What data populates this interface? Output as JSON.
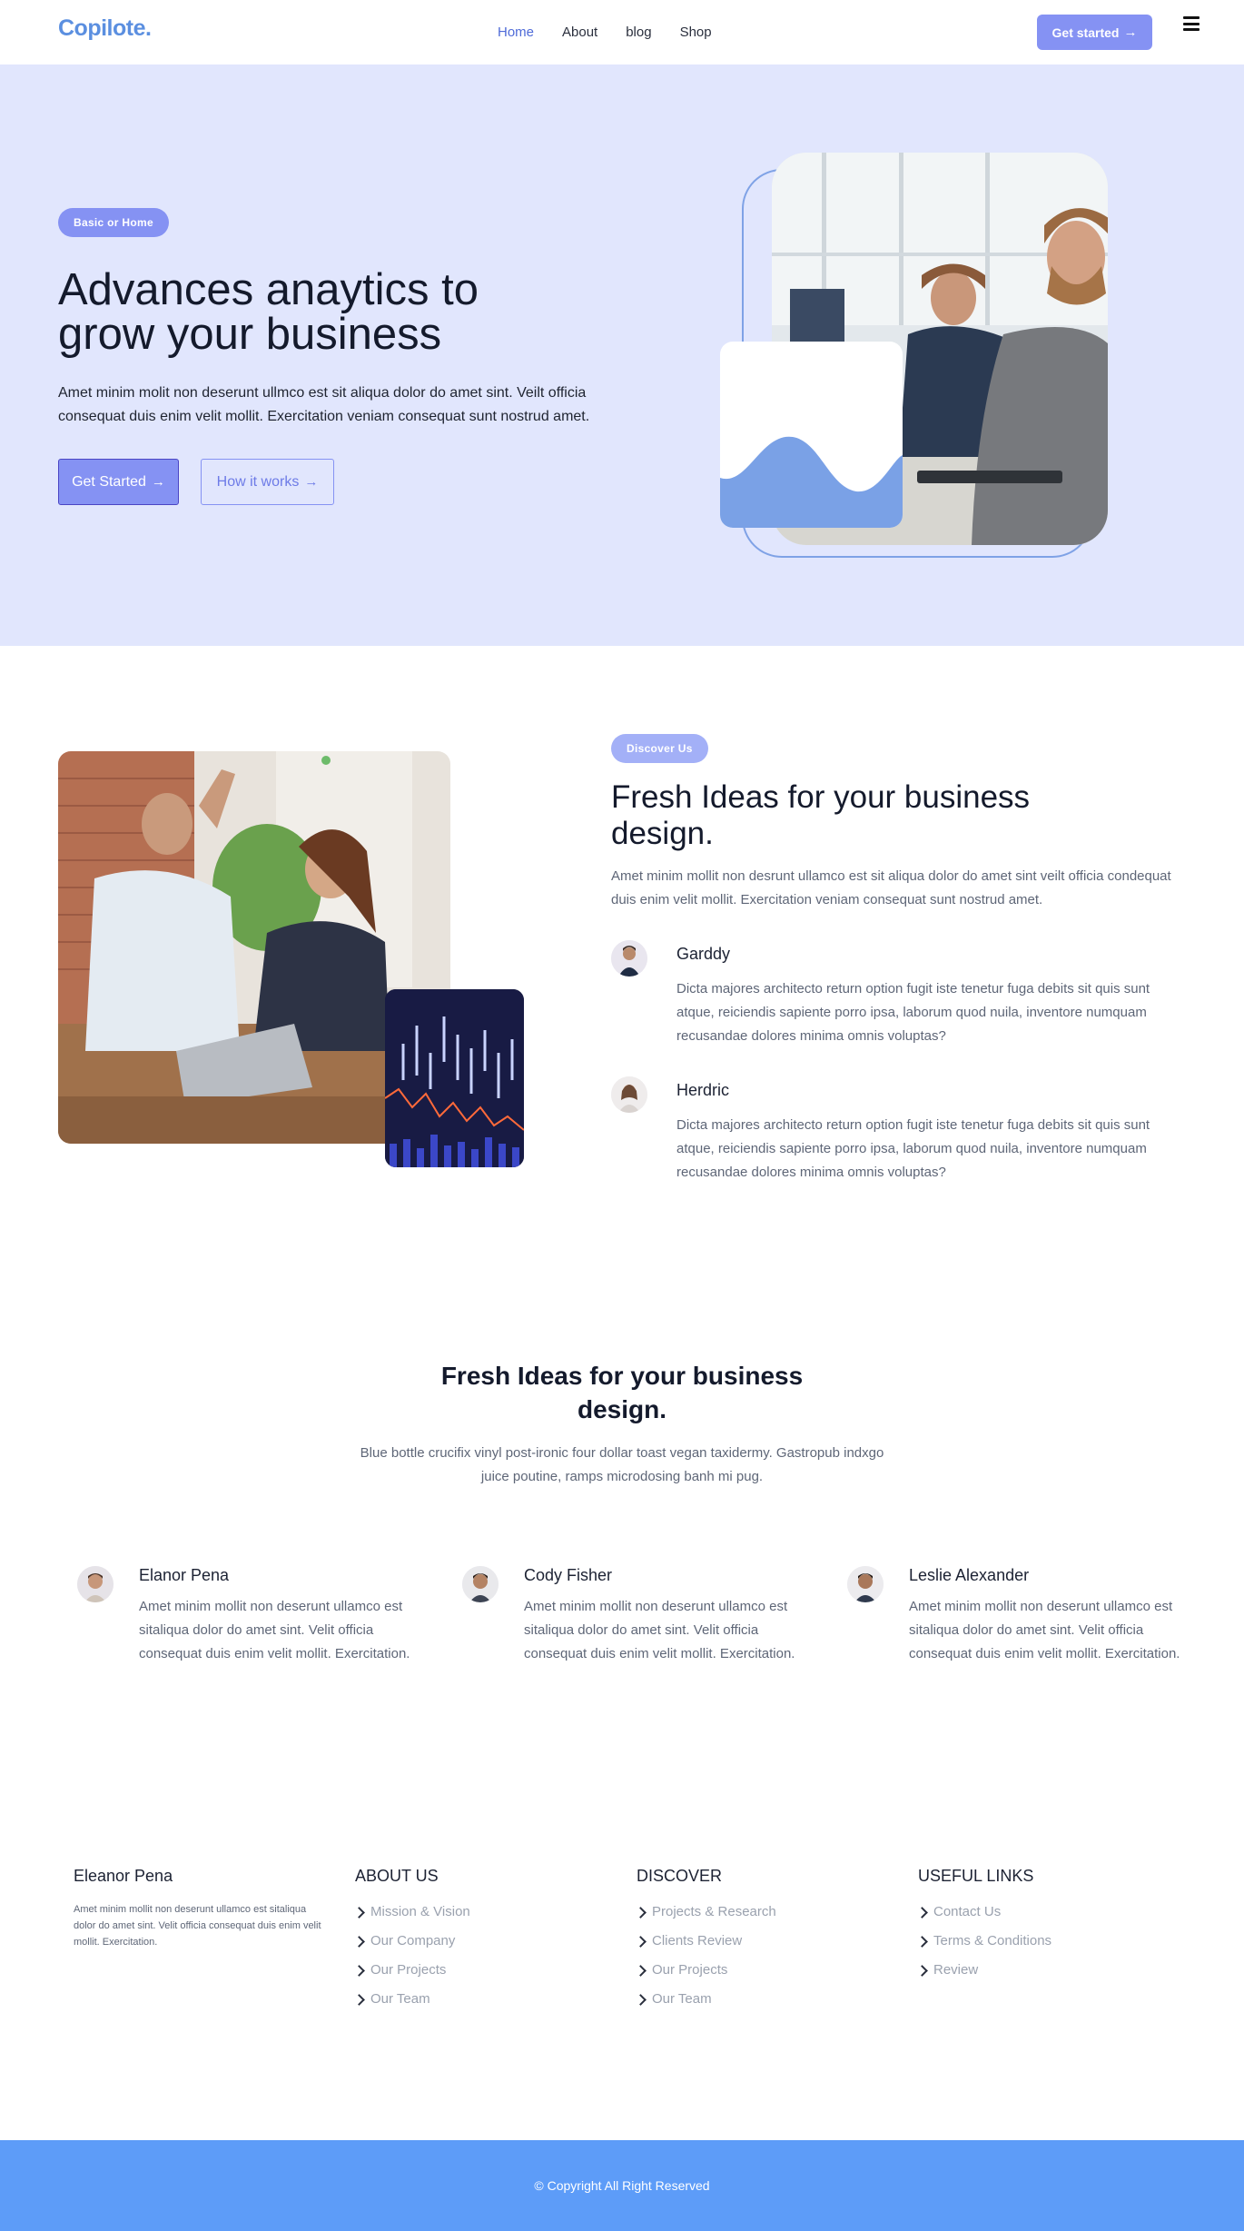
{
  "nav": {
    "logo": "Copilote.",
    "links": [
      {
        "label": "Home",
        "active": true
      },
      {
        "label": "About"
      },
      {
        "label": "blog"
      },
      {
        "label": "Shop"
      }
    ],
    "cta_label": "Get started",
    "menu_icon": "hamburger-icon"
  },
  "hero": {
    "badge": "Basic or Home",
    "title": "Advances anaytics to grow your business",
    "description": "Amet minim molit non deserunt ullmco est sit aliqua dolor do amet sint. Veilt officia consequat duis enim velit mollit. Exercitation veniam consequat sunt nostrud amet.",
    "primary_button": "Get Started",
    "secondary_button": "How it works",
    "image_icon": "office-photo-image",
    "card_icon": "wave-chart-card"
  },
  "discover": {
    "badge": "Discover Us",
    "title": "Fresh Ideas for your business design.",
    "description": "Amet minim mollit non desrunt ullamco est sit aliqua dolor do amet sint veilt officia condequat duis enim velit mollit. Exercitation veniam consequat sunt nostrud amet.",
    "people": [
      {
        "name": "Garddy",
        "text": "Dicta majores architecto return option fugit iste tenetur fuga debits sit quis sunt atque, reiciendis sapiente porro ipsa, laborum quod nuila, inventore numquam recusandae dolores minima omnis voluptas?"
      },
      {
        "name": "Herdric",
        "text": "Dicta majores architecto return option fugit iste tenetur fuga debits sit quis sunt atque, reiciendis sapiente porro ipsa, laborum quod nuila, inventore numquam recusandae dolores minima omnis voluptas?"
      }
    ]
  },
  "team_section": {
    "title": "Fresh Ideas for your business design.",
    "description": "Blue bottle crucifix vinyl post-ironic four dollar toast vegan taxidermy. Gastropub indxgo juice poutine, ramps microdosing banh mi pug.",
    "members": [
      {
        "name": "Elanor Pena",
        "text": "Amet minim mollit non deserunt ullamco est sitaliqua dolor do amet sint. Velit officia consequat duis enim velit mollit. Exercitation."
      },
      {
        "name": "Cody Fisher",
        "text": "Amet minim mollit non deserunt ullamco est sitaliqua dolor do amet sint. Velit officia consequat duis enim velit mollit. Exercitation."
      },
      {
        "name": "Leslie Alexander",
        "text": "Amet minim mollit non deserunt ullamco est sitaliqua dolor do amet sint. Velit officia consequat duis enim velit mollit. Exercitation."
      }
    ]
  },
  "footer": {
    "about_title": "Eleanor Pena",
    "about_text": "Amet minim mollit non deserunt ullamco est sitaliqua dolor do amet sint. Velit officia consequat duis enim velit mollit. Exercitation.",
    "columns": [
      {
        "title": "ABOUT US",
        "links": [
          "Mission & Vision",
          "Our Company",
          "Our Projects",
          "Our Team"
        ]
      },
      {
        "title": "DISCOVER",
        "links": [
          "Projects & Research",
          "Clients Review",
          "Our Projects",
          "Our Team"
        ]
      },
      {
        "title": "USEFUL LINKS",
        "links": [
          "Contact Us",
          "Terms & Conditions",
          "Review"
        ]
      }
    ],
    "copyright": "© Copyright All Right Reserved"
  },
  "colors": {
    "accent": "#8592f3",
    "hero_bg": "#e1e6fd",
    "footer_bar": "#5d9cf8",
    "logo": "#5b8fe0"
  }
}
